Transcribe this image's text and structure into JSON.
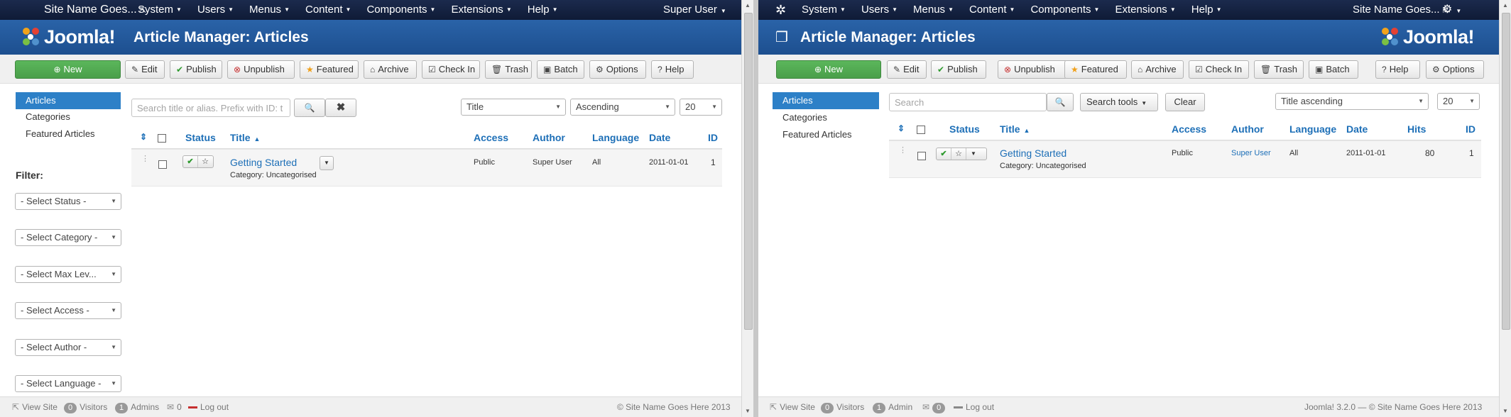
{
  "left": {
    "navbar": {
      "site_name": "Site Name Goes...",
      "menus": [
        "System",
        "Users",
        "Menus",
        "Content",
        "Components",
        "Extensions",
        "Help"
      ],
      "user": "Super User"
    },
    "header": {
      "title": "Article Manager: Articles",
      "logo_text": "Joomla!"
    },
    "toolbar": [
      "New",
      "Edit",
      "Publish",
      "Unpublish",
      "Featured",
      "Archive",
      "Check In",
      "Trash",
      "Batch",
      "Options",
      "Help"
    ],
    "sidebar": [
      "Articles",
      "Categories",
      "Featured Articles"
    ],
    "filter": {
      "title": "Filter:",
      "selects": [
        "- Select Status -",
        "- Select Category -",
        "- Select Max Lev...",
        "- Select Access -",
        "- Select Author -",
        "- Select Language -"
      ]
    },
    "search": {
      "placeholder": "Search title or alias. Prefix with ID: t"
    },
    "list": {
      "ordering": "Title",
      "direction": "Ascending",
      "limit": "20"
    },
    "table": {
      "headers": [
        "Status",
        "Title",
        "Access",
        "Author",
        "Language",
        "Date",
        "ID"
      ],
      "rows": [
        {
          "title": "Getting Started",
          "category": "Category: Uncategorised",
          "access": "Public",
          "author": "Super User",
          "language": "All",
          "date": "2011-01-01",
          "id": "1"
        }
      ]
    },
    "footer": {
      "view_site": "View Site",
      "visitors_count": "0",
      "visitors": "Visitors",
      "admins_count": "1",
      "admins": "Admins",
      "messages_count": "0",
      "logout": "Log out",
      "copyright": "© Site Name Goes Here 2013"
    }
  },
  "right": {
    "navbar": {
      "site_name": "Site Name Goes...",
      "menus": [
        "System",
        "Users",
        "Menus",
        "Content",
        "Components",
        "Extensions",
        "Help"
      ]
    },
    "header": {
      "title": "Article Manager: Articles",
      "logo_text": "Joomla!"
    },
    "toolbar": [
      "New",
      "Edit",
      "Publish",
      "Unpublish",
      "Featured",
      "Archive",
      "Check In",
      "Trash",
      "Batch",
      "Help",
      "Options"
    ],
    "sidebar": [
      "Articles",
      "Categories",
      "Featured Articles"
    ],
    "search": {
      "placeholder": "Search",
      "tools_label": "Search tools",
      "clear_label": "Clear"
    },
    "list": {
      "ordering": "Title ascending",
      "limit": "20"
    },
    "table": {
      "headers": [
        "Status",
        "Title",
        "Access",
        "Author",
        "Language",
        "Date",
        "Hits",
        "ID"
      ],
      "rows": [
        {
          "title": "Getting Started",
          "category": "Category: Uncategorised",
          "access": "Public",
          "author": "Super User",
          "language": "All",
          "date": "2011-01-01",
          "hits": "80",
          "id": "1"
        }
      ]
    },
    "footer": {
      "view_site": "View Site",
      "visitors_count": "0",
      "visitors": "Visitors",
      "admins_count": "1",
      "admin": "Admin",
      "messages_count": "0",
      "logout": "Log out",
      "version": "Joomla! 3.2.0",
      "copyright": "© Site Name Goes Here 2013"
    }
  },
  "colors": {
    "navbar": "#13213f",
    "header": "#2562a6",
    "accent": "#1d6fb7",
    "success": "#5bb75b"
  }
}
